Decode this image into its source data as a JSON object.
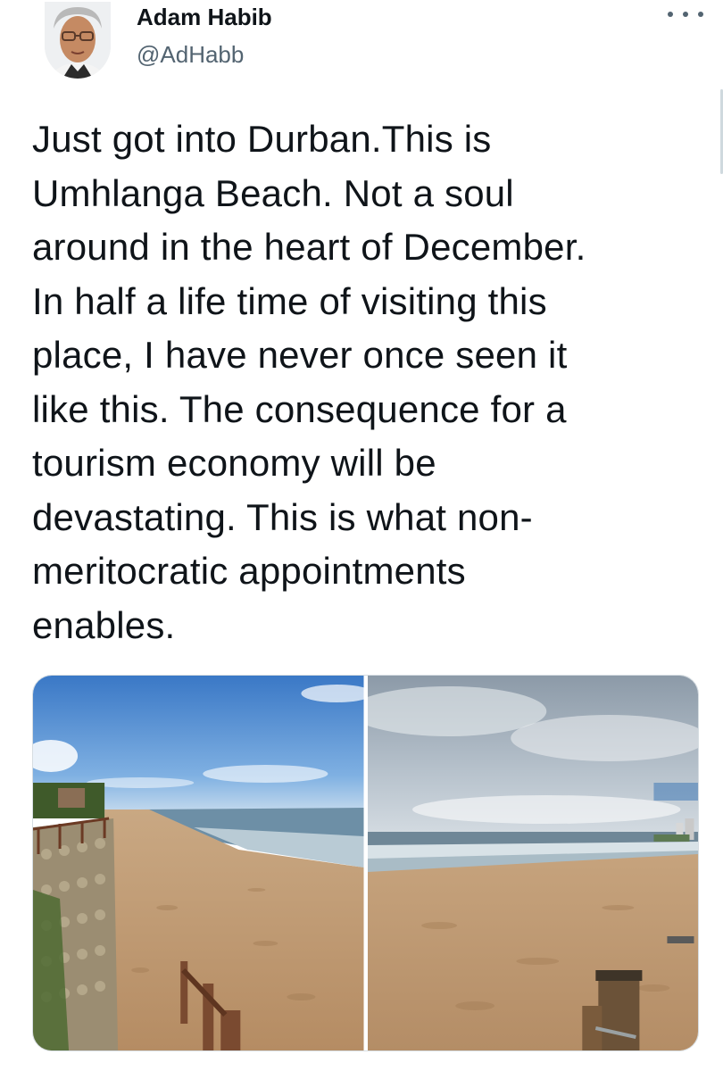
{
  "author": {
    "name": "Adam Habib",
    "handle": "@AdHabb"
  },
  "tweet": {
    "lines": [
      "Just got into Durban.This is",
      "Umhlanga Beach. Not a soul",
      "around in the heart of December.",
      "In half a life time of visiting this",
      "place, I have never once seen it",
      "like this. The consequence for a",
      "tourism economy will be",
      "devastating. This is what non-",
      "meritocratic appointments",
      "enables."
    ]
  },
  "media": {
    "count": 2
  },
  "icons": {
    "more": "more-horizontal-icon"
  },
  "colors": {
    "text": "#0f1419",
    "secondary_text": "#536471"
  }
}
